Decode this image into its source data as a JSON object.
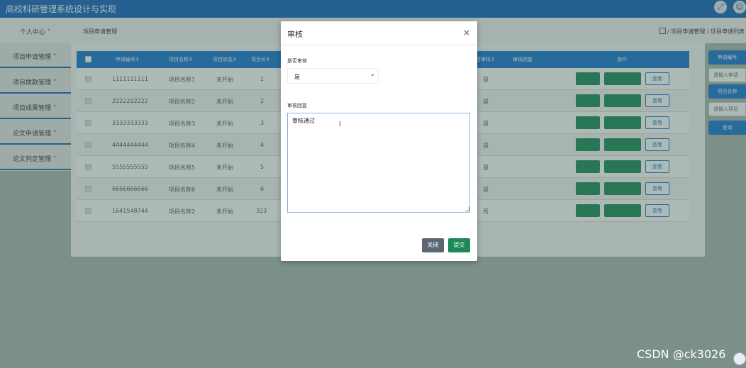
{
  "app": {
    "title": "高校科研管理系统设计与实现"
  },
  "topbar": {
    "fullscreen_icon": "expand-icon",
    "user_icon": "user-icon"
  },
  "nav": {
    "user_menu": "个人中心 ˅",
    "page_label": "项目申请管理",
    "breadcrumb": "/ 项目申请管理 / 项目申请列表"
  },
  "sidebar": {
    "items": [
      {
        "label": "项目申请管理 ˅"
      },
      {
        "label": "项目拨款管理 ˅"
      },
      {
        "label": "项目成果管理 ˅"
      },
      {
        "label": "论文申请管理 ˅"
      },
      {
        "label": "论文判定管理 ˅"
      }
    ]
  },
  "table": {
    "headers": [
      "申请编号⇕",
      "项目名称⇕",
      "项目状态⇕",
      "项目价⇕",
      "否审核⇕",
      "审核回复",
      "操作"
    ],
    "rows": [
      {
        "id": "1111111111",
        "name": "项目名称1",
        "status": "未开始",
        "price": "1",
        "audit": "是"
      },
      {
        "id": "2222222222",
        "name": "项目名称2",
        "status": "未开始",
        "price": "2",
        "audit": "是"
      },
      {
        "id": "3333333333",
        "name": "项目名称3",
        "status": "未开始",
        "price": "3",
        "audit": "是"
      },
      {
        "id": "4444444444",
        "name": "项目名称4",
        "status": "未开始",
        "price": "4",
        "audit": "是"
      },
      {
        "id": "5555555555",
        "name": "项目名称5",
        "status": "未开始",
        "price": "5",
        "audit": "是"
      },
      {
        "id": "6666666666",
        "name": "项目名称6",
        "status": "未开始",
        "price": "6",
        "audit": "是"
      },
      {
        "id": "1641548744",
        "name": "项目名称2",
        "status": "未开始",
        "price": "323",
        "audit": "否"
      }
    ],
    "view_label": "查看"
  },
  "search": {
    "id_label": "申请编号",
    "id_placeholder": "请输入申请",
    "name_label": "项目名称",
    "name_placeholder": "请输入项目",
    "query_label": "查询"
  },
  "modal": {
    "title": "审核",
    "close_glyph": "×",
    "field_audit_label": "是否审核",
    "field_audit_value": "是",
    "field_reply_label": "审核回复",
    "field_reply_value": "审核通过",
    "close_button": "关闭",
    "submit_button": "提交"
  },
  "watermark": "CSDN @ck3026"
}
